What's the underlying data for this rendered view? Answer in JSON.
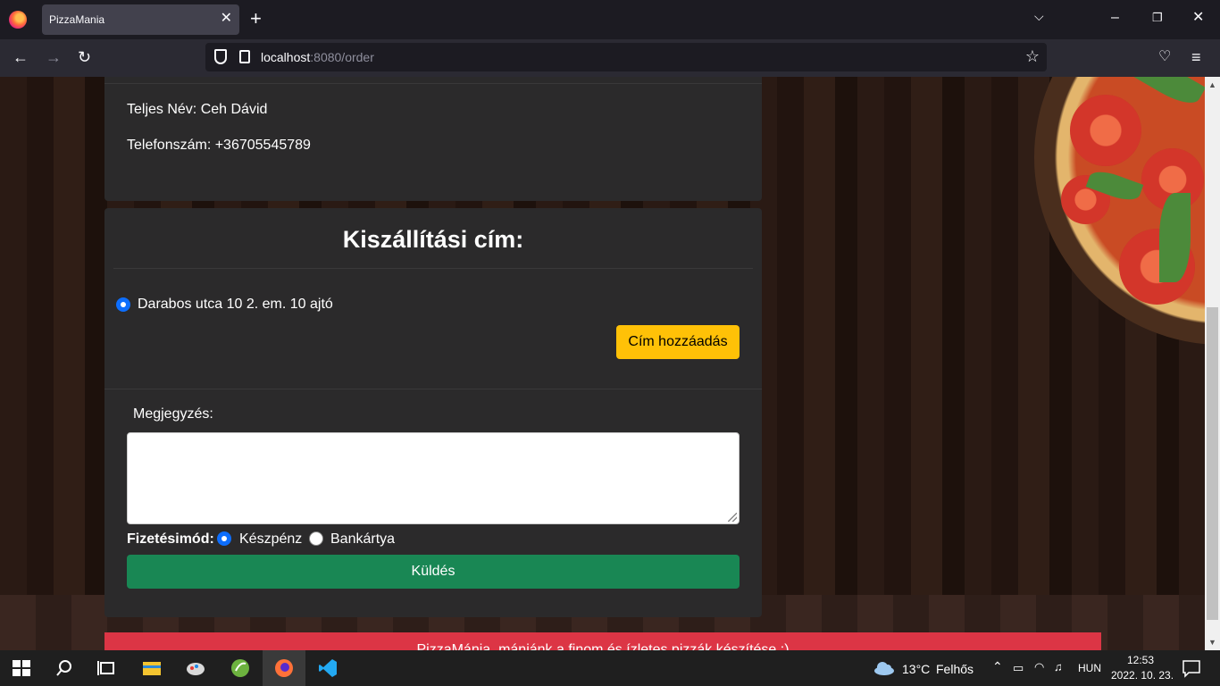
{
  "browser": {
    "tab_title": "PizzaMania",
    "url_host": "localhost",
    "url_rest": ":8080/order",
    "tab_close": "✕",
    "new_tab": "+"
  },
  "contact": {
    "name_line": "Teljes Név: Ceh Dávid",
    "phone_line": "Telefonszám: +36705545789"
  },
  "delivery": {
    "title": "Kiszállítási cím:",
    "address": "Darabos utca 10 2. em. 10 ajtó",
    "add_address_button": "Cím hozzáadás"
  },
  "order": {
    "note_label": "Megjegyzés:",
    "note_value": "",
    "payment_label": "Fizetésimód:",
    "payment_options": [
      "Készpénz",
      "Bankártya"
    ],
    "payment_selected": "Készpénz",
    "submit_button": "Küldés"
  },
  "footer": {
    "text": "PizzaMánia, mániánk a finom és ízletes pizzák készítése :)"
  },
  "taskbar": {
    "weather_temp": "13°C",
    "weather_text": "Felhős",
    "language": "HUN",
    "time": "12:53",
    "date": "2022. 10. 23."
  },
  "colors": {
    "accent_yellow": "#ffc107",
    "accent_green": "#198754",
    "accent_red": "#dc3545",
    "radio_blue": "#0d6efd"
  }
}
